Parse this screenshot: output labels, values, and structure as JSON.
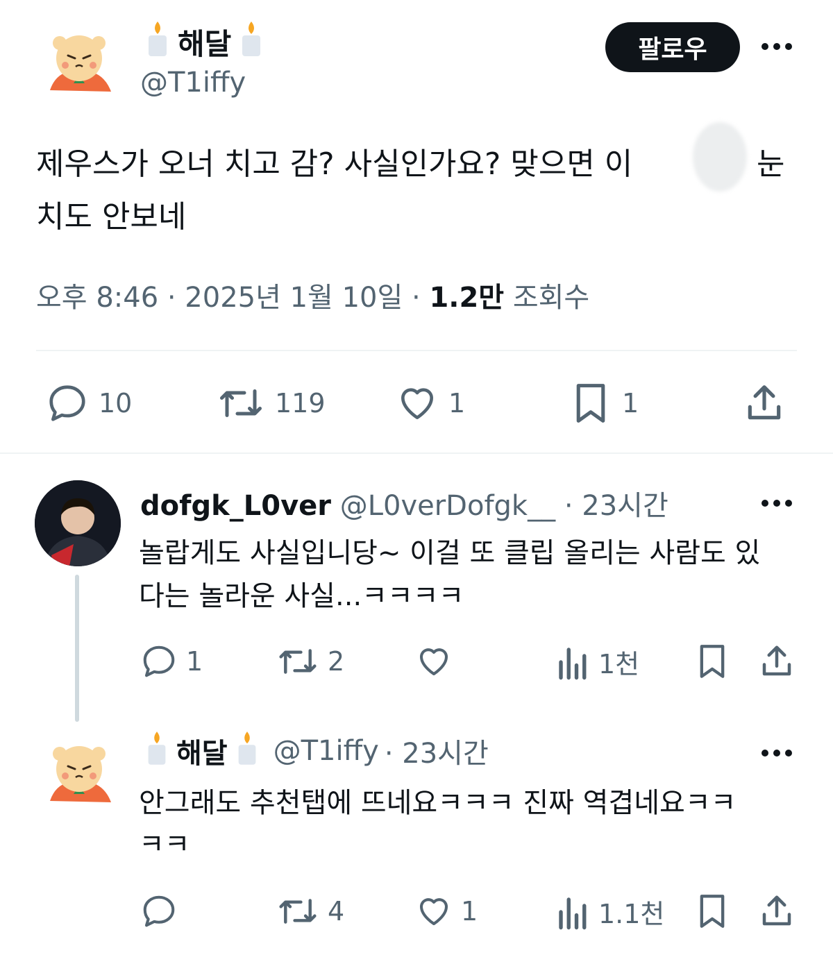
{
  "colors": {
    "text": "#0f1419",
    "secondary": "#536471",
    "divider": "#eff3f4",
    "follow_bg": "#0f1419",
    "follow_text": "#ffffff",
    "thread_line": "#cfd9de"
  },
  "main_tweet": {
    "author_name": "해달",
    "author_name_emoji": "🕯️",
    "author_handle": "@T1iffy",
    "avatar_icon": "bear-avatar-icon",
    "follow_label": "팔로우",
    "text_line1": "제우스가 오너 치고 감? 사실인가요? 맞으면 이",
    "text_line1_end": "눈",
    "text_line2": "치도 안보네",
    "time": "오후 8:46",
    "date": "2025년 1월 10일",
    "separator": "·",
    "views_count": "1.2만",
    "views_label": "조회수",
    "actions": {
      "replies": "10",
      "retweets": "119",
      "likes": "1",
      "bookmarks": "1"
    }
  },
  "replies": [
    {
      "author_name": "dofgk_L0ver",
      "author_handle": "@L0verDofgk__",
      "time_label": "· 23시간",
      "avatar_icon": "person-avatar-icon",
      "text_line1": "놀랍게도 사실입니당~ 이걸 또 클립 올리는 사람도 있",
      "text_line2": "다는 놀라운 사실...ㅋㅋㅋㅋ",
      "actions": {
        "replies": "1",
        "retweets": "2",
        "likes": "",
        "views": "1천"
      }
    },
    {
      "author_name": "해달",
      "author_handle": "@T1iffy",
      "time_label": "· 23시간",
      "avatar_icon": "bear-avatar-icon",
      "text_line1": "안그래도 추천탭에 뜨네요ㅋㅋㅋ 진짜 역겹네요ㅋㅋ",
      "text_line2": "ㅋㅋ",
      "actions": {
        "replies": "",
        "retweets": "4",
        "likes": "1",
        "views": "1.1천"
      }
    }
  ]
}
